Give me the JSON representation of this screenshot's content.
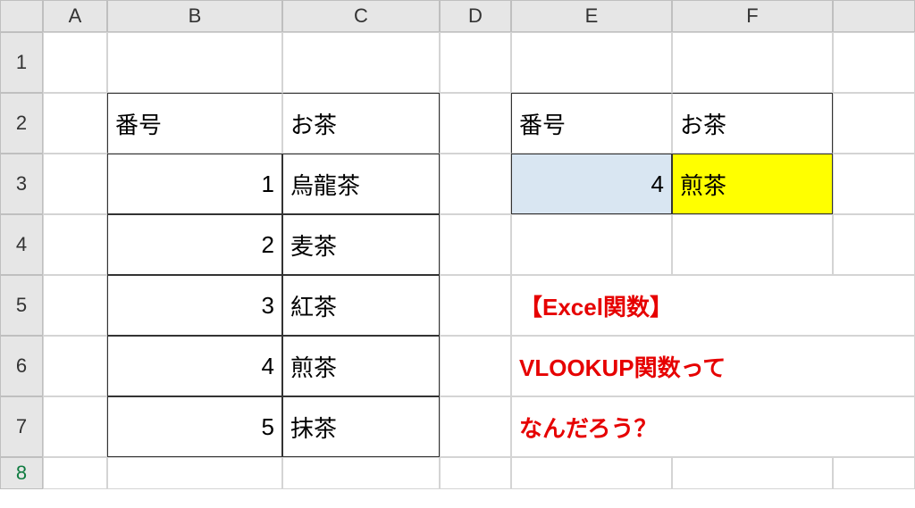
{
  "columns": [
    "A",
    "B",
    "C",
    "D",
    "E",
    "F",
    ""
  ],
  "rows": [
    "1",
    "2",
    "3",
    "4",
    "5",
    "6",
    "7",
    "8"
  ],
  "table1": {
    "header_num": "番号",
    "header_tea": "お茶",
    "rows": [
      {
        "n": "1",
        "t": "烏龍茶"
      },
      {
        "n": "2",
        "t": "麦茶"
      },
      {
        "n": "3",
        "t": "紅茶"
      },
      {
        "n": "4",
        "t": "煎茶"
      },
      {
        "n": "5",
        "t": "抹茶"
      }
    ]
  },
  "table2": {
    "header_num": "番号",
    "header_tea": "お茶",
    "lookup_n": "4",
    "lookup_t": "煎茶"
  },
  "caption": {
    "line1": "【Excel関数】",
    "line2": "VLOOKUP関数って",
    "line3": "なんだろう？"
  }
}
